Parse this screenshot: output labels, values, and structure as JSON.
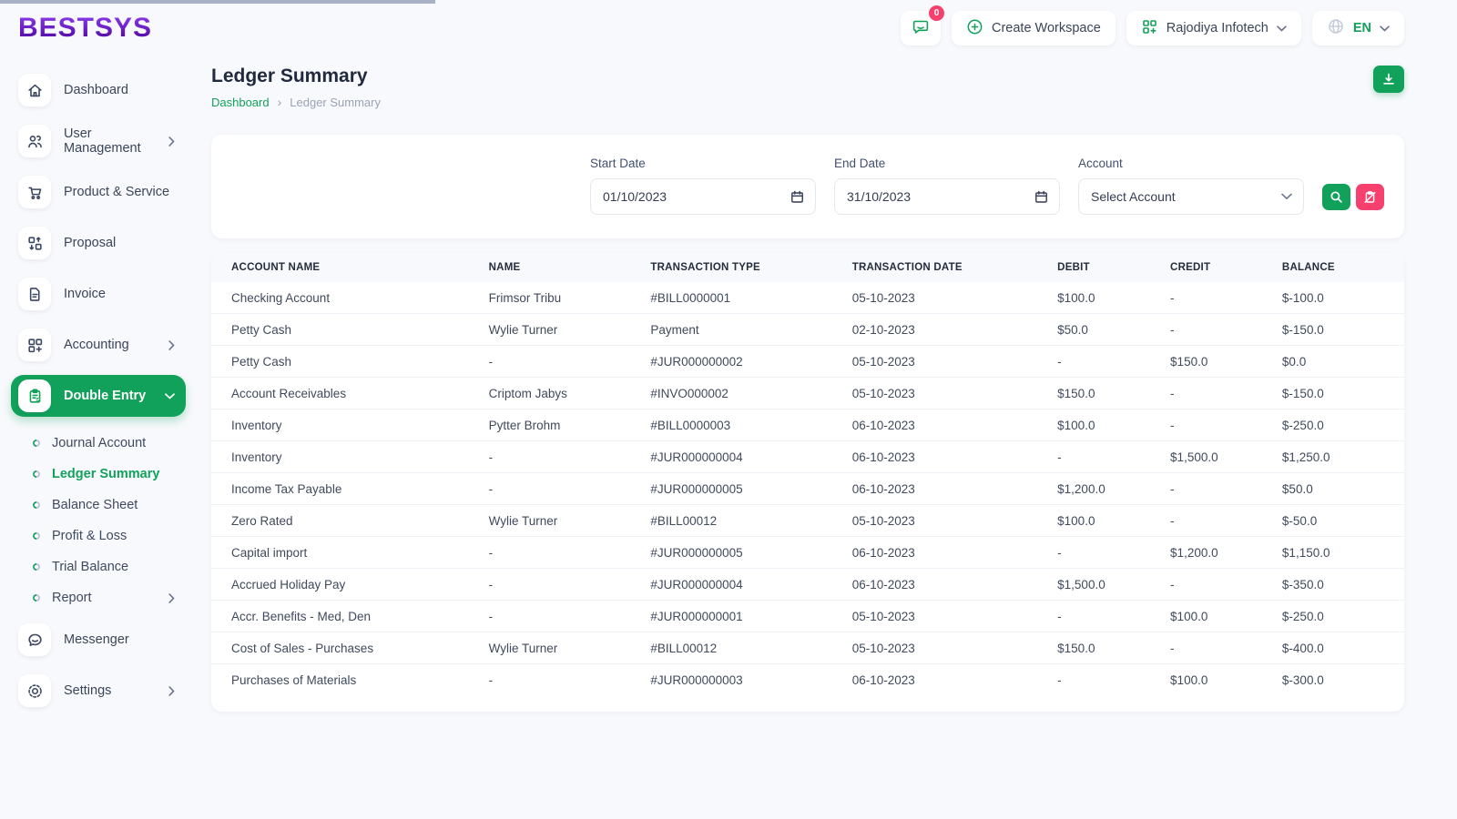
{
  "colors": {
    "primary_green": "#12a15b",
    "accent_pink": "#f7406d",
    "logo_purple": "#5a10ae",
    "progress_gray": "#a9b1c5"
  },
  "brand": {
    "name": "BESTSYS"
  },
  "topbar": {
    "chat_badge": "0",
    "create_workspace_label": "Create Workspace",
    "workspace_name": "Rajodiya Infotech",
    "language": "EN"
  },
  "sidebar": {
    "items": [
      {
        "label": "Dashboard"
      },
      {
        "label": "User Management"
      },
      {
        "label": "Product & Service"
      },
      {
        "label": "Proposal"
      },
      {
        "label": "Invoice"
      },
      {
        "label": "Accounting"
      },
      {
        "label": "Double Entry"
      }
    ],
    "submenu": [
      {
        "label": "Journal Account"
      },
      {
        "label": "Ledger Summary",
        "active": true
      },
      {
        "label": "Balance Sheet"
      },
      {
        "label": "Profit & Loss"
      },
      {
        "label": "Trial Balance"
      },
      {
        "label": "Report"
      }
    ],
    "messenger_label": "Messenger",
    "settings_label": "Settings"
  },
  "page": {
    "title": "Ledger Summary",
    "breadcrumb_home": "Dashboard",
    "breadcrumb_current": "Ledger Summary"
  },
  "filters": {
    "start_date_label": "Start Date",
    "start_date_value": "01/10/2023",
    "end_date_label": "End Date",
    "end_date_value": "31/10/2023",
    "account_label": "Account",
    "account_value": "Select Account"
  },
  "table": {
    "columns": [
      "ACCOUNT NAME",
      "NAME",
      "TRANSACTION TYPE",
      "TRANSACTION DATE",
      "DEBIT",
      "CREDIT",
      "BALANCE"
    ],
    "rows": [
      [
        "Checking Account",
        "Frimsor Tribu",
        "#BILL0000001",
        "05-10-2023",
        "$100.0",
        "-",
        "$-100.0"
      ],
      [
        "Petty Cash",
        "Wylie Turner",
        "Payment",
        "02-10-2023",
        "$50.0",
        "-",
        "$-150.0"
      ],
      [
        "Petty Cash",
        "-",
        "#JUR000000002",
        "05-10-2023",
        "-",
        "$150.0",
        "$0.0"
      ],
      [
        "Account Receivables",
        "Criptom Jabys",
        "#INVO000002",
        "05-10-2023",
        "$150.0",
        "-",
        "$-150.0"
      ],
      [
        "Inventory",
        "Pytter Brohm",
        "#BILL0000003",
        "06-10-2023",
        "$100.0",
        "-",
        "$-250.0"
      ],
      [
        "Inventory",
        "-",
        "#JUR000000004",
        "06-10-2023",
        "-",
        "$1,500.0",
        "$1,250.0"
      ],
      [
        "Income Tax Payable",
        "-",
        "#JUR000000005",
        "06-10-2023",
        "$1,200.0",
        "-",
        "$50.0"
      ],
      [
        "Zero Rated",
        "Wylie Turner",
        "#BILL00012",
        "05-10-2023",
        "$100.0",
        "-",
        "$-50.0"
      ],
      [
        "Capital import",
        "-",
        "#JUR000000005",
        "06-10-2023",
        "-",
        "$1,200.0",
        "$1,150.0"
      ],
      [
        "Accrued Holiday Pay",
        "-",
        "#JUR000000004",
        "06-10-2023",
        "$1,500.0",
        "-",
        "$-350.0"
      ],
      [
        "Accr. Benefits - Med, Den",
        "-",
        "#JUR000000001",
        "05-10-2023",
        "-",
        "$100.0",
        "$-250.0"
      ],
      [
        "Cost of Sales - Purchases",
        "Wylie Turner",
        "#BILL00012",
        "05-10-2023",
        "$150.0",
        "-",
        "$-400.0"
      ],
      [
        "Purchases of Materials",
        "-",
        "#JUR000000003",
        "06-10-2023",
        "-",
        "$100.0",
        "$-300.0"
      ]
    ]
  }
}
